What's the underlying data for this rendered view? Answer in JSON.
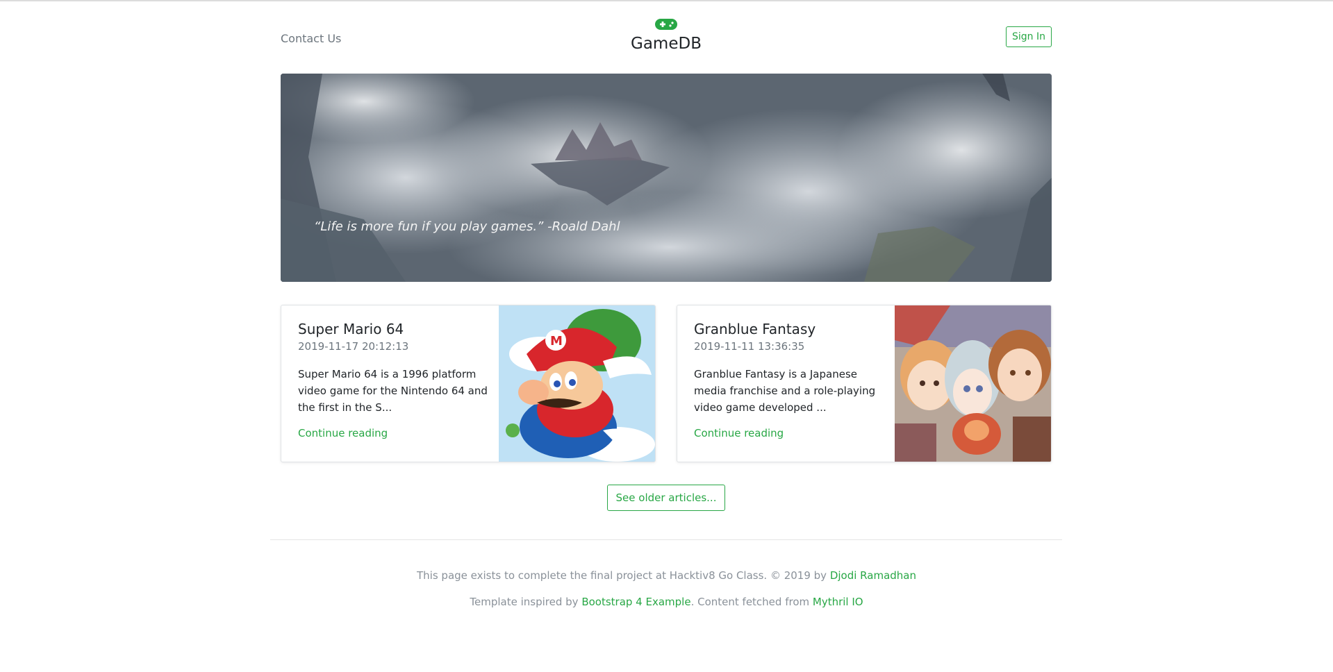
{
  "header": {
    "contact_label": "Contact Us",
    "brand_title": "GameDB",
    "brand_icon": "gamepad-icon",
    "signin_label": "Sign In"
  },
  "hero": {
    "quote": "“Life is more fun if you play games.” -Roald Dahl"
  },
  "articles": [
    {
      "title": "Super Mario 64",
      "date": "2019-11-17 20:12:13",
      "excerpt": "Super Mario 64 is a 1996 platform video game for the Nintendo 64 and the first in the S...",
      "link_label": "Continue reading"
    },
    {
      "title": "Granblue Fantasy",
      "date": "2019-11-11 13:36:35",
      "excerpt": "Granblue Fantasy is a Japanese media franchise and a role-playing video game developed ...",
      "link_label": "Continue reading"
    }
  ],
  "older_label": "See older articles...",
  "footer": {
    "line1_text": "This page exists to complete the final project at Hacktiv8 Go Class. © 2019 by ",
    "line1_link": "Djodi Ramadhan",
    "line2_text_a": "Template inspired by ",
    "line2_link_a": "Bootstrap 4 Example",
    "line2_text_b": ". Content fetched from ",
    "line2_link_b": "Mythril IO"
  },
  "colors": {
    "accent": "#28a745",
    "muted": "#6c757d"
  }
}
